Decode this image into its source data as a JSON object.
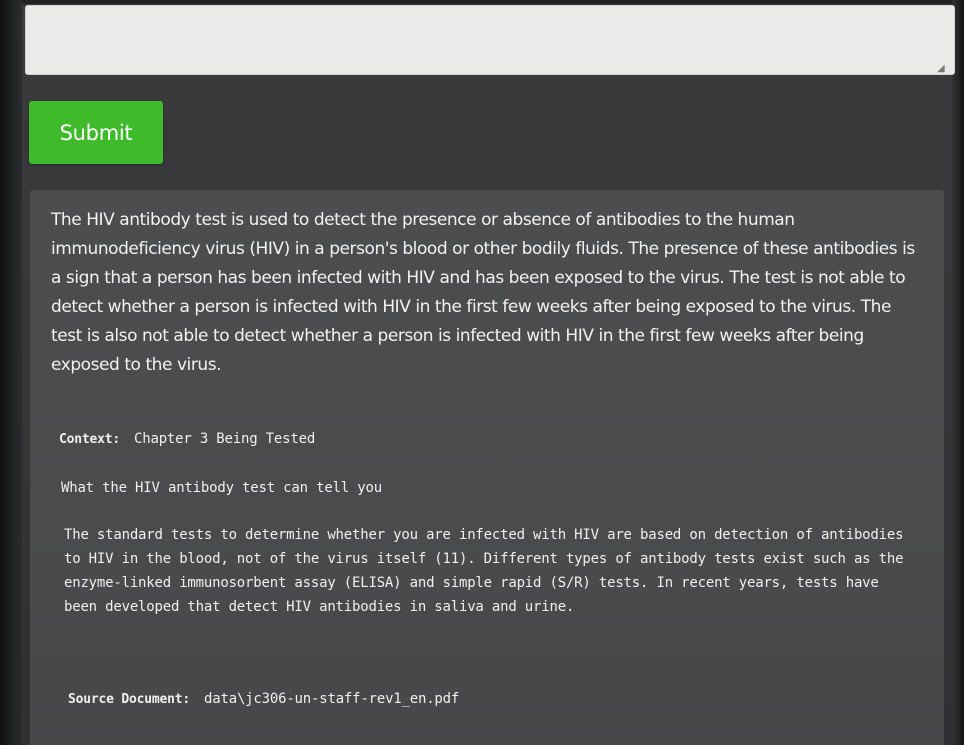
{
  "input": {
    "value": "",
    "placeholder": ""
  },
  "submit_button": {
    "label": "Submit",
    "color": "#3fba2b"
  },
  "response": {
    "answer": "The HIV antibody test is used to detect the presence or absence of antibodies to the human immunodeficiency virus (HIV) in a person's blood or other bodily fluids. The presence of these antibodies is a sign that a person has been infected with HIV and has been exposed to the virus. The test is not able to detect whether a person is infected with HIV in the first few weeks after being exposed to the virus. The test is also not able to detect whether a person is infected with HIV in the first few weeks after being exposed to the virus.",
    "context_label": "Context:",
    "context_value": "Chapter 3 Being Tested",
    "context_heading": "What the HIV antibody test can tell you",
    "context_passage": "The standard tests to determine whether you are infected with HIV are based on detection of antibodies to HIV in the blood, not of the virus itself (11). Different types of antibody tests exist such as the enzyme-linked immunosorbent assay (ELISA) and simple rapid (S/R) tests. In recent years, tests have been developed that detect HIV antibodies in saliva and urine.",
    "source_label": "Source Document:",
    "source_value": "data\\jc306-un-staff-rev1_en.pdf"
  }
}
